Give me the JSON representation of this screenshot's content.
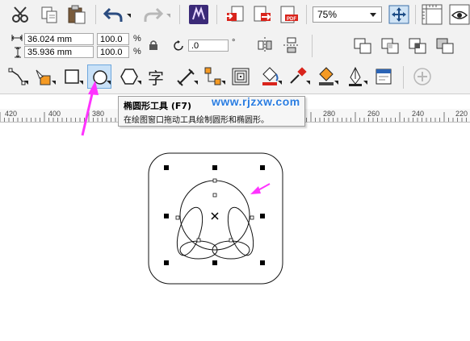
{
  "colors": {
    "toolbar_bg": "#f2f2f2",
    "highlight": "#c9e1f7",
    "annotation_arrow": "#ff33ff",
    "watermark": "#2a7de1",
    "pdf_red": "#d9241c",
    "undo_blue": "#2b4c80"
  },
  "standard_toolbar": {
    "icons": [
      "cut-icon",
      "copy-icon",
      "paste-icon",
      "undo-icon",
      "redo-icon",
      "corel-connect-icon",
      "import-icon",
      "export-icon",
      "publish-pdf-icon",
      "full-screen-preview-icon",
      "zoom-to-page-icon",
      "rulers-icon",
      "view-icon"
    ],
    "zoom": {
      "value": "75%"
    }
  },
  "property_bar": {
    "width": "36.024 mm",
    "height": "35.936 mm",
    "scale_x": "100.0",
    "scale_y": "100.0",
    "percent_symbol": "%",
    "rotation": ".0",
    "degree_symbol": "°"
  },
  "toolbox": {
    "tools": [
      "shape-tool",
      "smart-fill-tool",
      "rectangle-tool",
      "ellipse-tool",
      "polygon-tool",
      "text-tool",
      "dimension-tool",
      "connector-tool",
      "contour-tool",
      "fill-tool",
      "eyedropper-tool",
      "interactive-fill-tool",
      "pen-tool",
      "object-properties",
      "add-tool"
    ],
    "text_tool_glyph": "字"
  },
  "ruler": {
    "ticks": [
      "420",
      "400",
      "380",
      "280",
      "260",
      "240",
      "220"
    ]
  },
  "tooltip": {
    "title": "椭圆形工具 (F7)",
    "description": "在绘图窗口拖动工具绘制圆形和椭圆形。"
  },
  "watermark": "www.rjzxw.com"
}
